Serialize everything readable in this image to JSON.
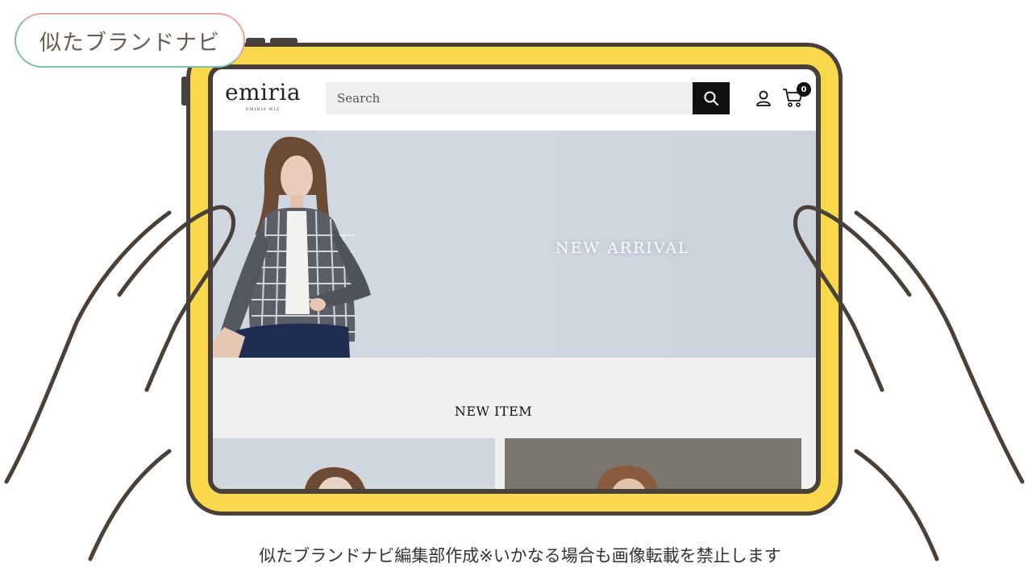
{
  "brand_tag": {
    "label": "似たブランドナビ"
  },
  "site": {
    "logo": {
      "main": "emiria",
      "sub": "EMIRIA WIZ"
    },
    "search": {
      "placeholder": "Search"
    },
    "cart": {
      "count": "0"
    }
  },
  "hero": {
    "title": "NEW ARRIVAL"
  },
  "new_item": {
    "title": "NEW ITEM"
  },
  "caption": "似たブランドナビ編集部作成※いかなる場合も画像転載を禁止します",
  "colors": {
    "tablet_frame": "#f9d84e",
    "outline": "#4a403a",
    "tag_pink": "#e8a3a3",
    "tag_green": "#7fbfae"
  },
  "icons": [
    "search-icon",
    "account-icon",
    "cart-icon"
  ]
}
